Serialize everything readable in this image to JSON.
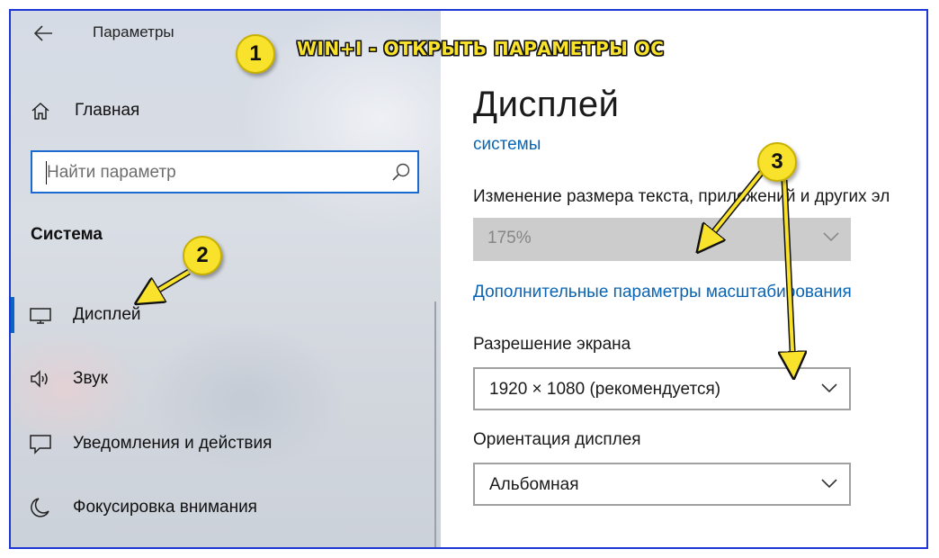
{
  "window": {
    "title": "Параметры",
    "back_icon": "back-arrow-icon"
  },
  "sidebar": {
    "home_label": "Главная",
    "search": {
      "placeholder": "Найти параметр",
      "value": ""
    },
    "section_title": "Система",
    "items": [
      {
        "label": "Дисплей",
        "icon": "monitor-icon",
        "selected": true
      },
      {
        "label": "Звук",
        "icon": "speaker-icon",
        "selected": false
      },
      {
        "label": "Уведомления и действия",
        "icon": "notification-icon",
        "selected": false
      },
      {
        "label": "Фокусировка внимания",
        "icon": "moon-icon",
        "selected": false
      }
    ]
  },
  "main": {
    "page_title": "Дисплей",
    "partial_link": "системы",
    "scale_label": "Изменение размера текста, приложений и других эл",
    "scale_value": "175%",
    "advanced_scaling_link": "Дополнительные параметры масштабирования",
    "resolution_label": "Разрешение экрана",
    "resolution_value": "1920 × 1080 (рекомендуется)",
    "orientation_label": "Ориентация дисплея",
    "orientation_value": "Альбомная"
  },
  "annotations": {
    "badge_1": "1",
    "badge_2": "2",
    "badge_3": "3",
    "caption": "WIN+I - ОТКРЫТЬ ПАРАМЕТРЫ ОС"
  },
  "colors": {
    "accent": "#0a64c8",
    "link": "#0a64b4",
    "annotation_yellow": "#f8e22b",
    "frame_border": "#1d37d6"
  }
}
